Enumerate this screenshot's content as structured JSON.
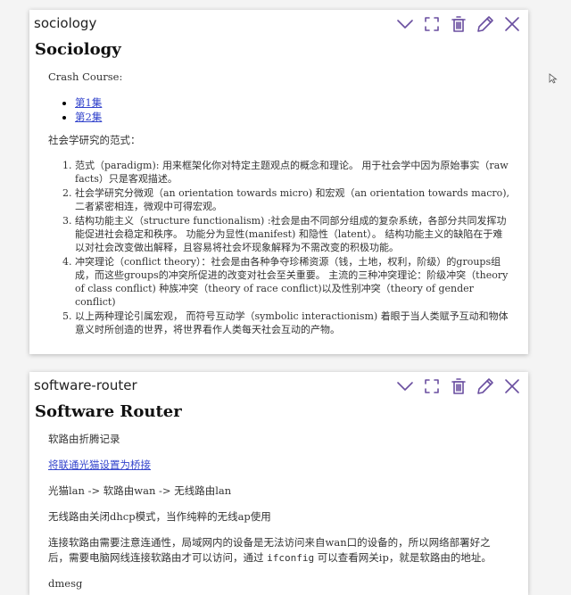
{
  "cards": [
    {
      "name": "sociology",
      "title": "Sociology",
      "intro": "Crash Course:",
      "links": [
        "第1集",
        "第2集"
      ],
      "paradigm_heading": "社会学研究的范式：",
      "items": [
        "范式（paradigm): 用来框架化你对特定主题观点的概念和理论。 用于社会学中因为原始事实（raw facts）只是客观描述。",
        "社会学研究分微观（an orientation towards micro) 和宏观（an orientation towards macro),二者紧密相连，微观中可得宏观。",
        "结构功能主义（structure functionalism) :社会是由不同部分组成的复杂系统，各部分共同发挥功能促进社会稳定和秩序。 功能分为显性(manifest) 和隐性（latent）。 结构功能主义的缺陷在于难以对社会改变做出解释，且容易将社会坏现象解释为不需改变的积极功能。",
        "冲突理论（conflict theory）：社会是由各种争夺珍稀资源（钱，土地，权利，阶级）的groups组成，而这些groups的冲突所促进的改变对社会至关重要。 主流的三种冲突理论：阶级冲突（theory of class conflict) 种族冲突（theory of race conflict)以及性别冲突（theory of gender conflict)",
        "以上两种理论引属宏观， 而符号互动学（symbolic interactionism) 着眼于当人类赋予互动和物体意义时所创造的世界，将世界看作人类每天社会互动的产物。"
      ]
    },
    {
      "name": "software-router",
      "title": "Software Router",
      "p1": "软路由折腾记录",
      "link": "将联通光猫设置为桥接",
      "p2": "光猫lan -> 软路由wan -> 无线路由lan",
      "p3": "无线路由关闭dhcp模式，当作纯粹的无线ap使用",
      "p4_before": "连接软路由需要注意连通性，局域网内的设备是无法访问来自wan口的设备的，所以网络部署好之后，需要电脑网线连接软路由才可以访问，通过 ",
      "p4_code": "ifconfig",
      "p4_after": " 可以查看网关ip，就是软路由的地址。",
      "p5": "dmesg"
    }
  ],
  "actions": [
    "chevron-down-icon",
    "fullscreen-icon",
    "trash-icon",
    "pencil-icon",
    "close-icon"
  ],
  "colors": {
    "accent": "#6a4fa0",
    "link": "#3344cc"
  }
}
